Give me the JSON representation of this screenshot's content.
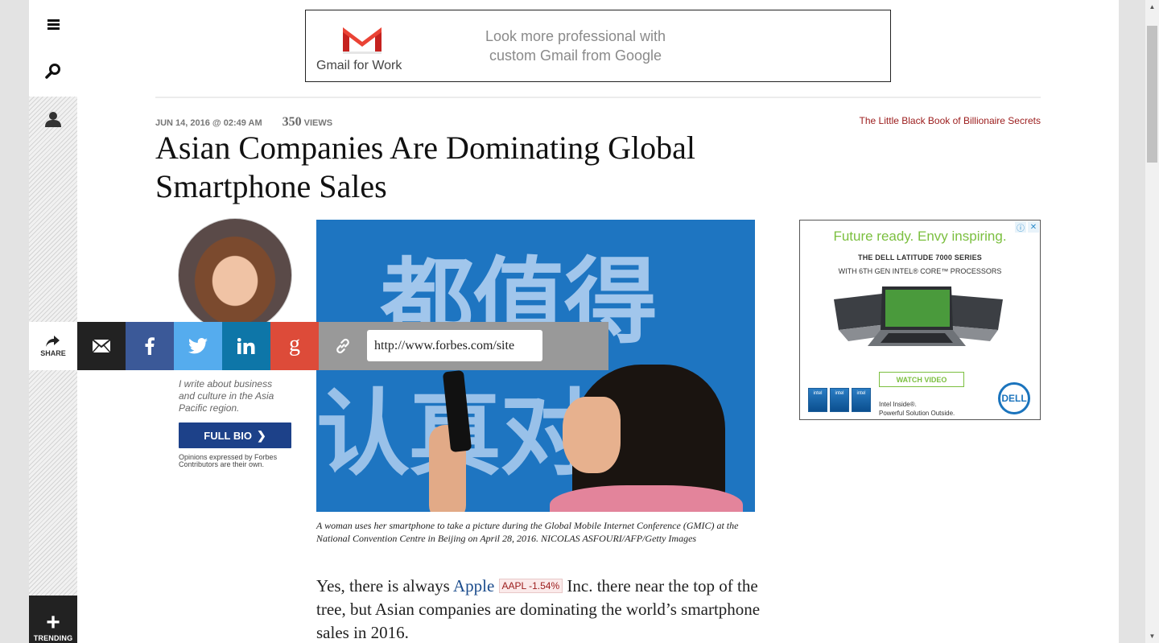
{
  "top_ad": {
    "brand": "Gmail for Work",
    "copy": "Look more professional with custom Gmail from Google"
  },
  "article": {
    "date": "JUN 14, 2016 @ 02:49 AM",
    "views_count": "350",
    "views_label": "VIEWS",
    "promo_link": "The Little Black Book of Billionaire Secrets",
    "headline": "Asian Companies Are Dominating Global Smartphone Sales",
    "caption": "A woman uses her smartphone to take a picture during the Global Mobile Internet Conference (GMIC) at the National Convention Centre in Beijing on April 28, 2016. NICOLAS ASFOURI/AFP/Getty Images",
    "body_before": "Yes, there is always ",
    "body_link": "Apple",
    "ticker": "AAPL -1.54%",
    "body_after": " Inc. there near the top of the tree, but Asian companies are dominating the world’s smartphone sales in 2016."
  },
  "author": {
    "bio": "I write about business and culture in the Asia Pacific region.",
    "full_bio_label": "FULL BIO",
    "disclaimer": "Opinions expressed by Forbes Contributors are their own."
  },
  "share": {
    "label": "SHARE",
    "url": "http://www.forbes.com/site"
  },
  "rail": {
    "trending_label": "TRENDING"
  },
  "side_ad": {
    "headline": "Future ready. Envy inspiring.",
    "line1": "THE DELL LATITUDE 7000 SERIES",
    "line2": "WITH 6TH GEN INTEL® CORE™ PROCESSORS",
    "cta": "WATCH VIDEO",
    "intel1": "Intel Inside®.",
    "intel2": "Powerful Solution Outside.",
    "logo": "DELL"
  },
  "colors": {
    "page_bg": "#e3e3e3",
    "headline_link": "#9b1b1b",
    "full_bio_bg": "#1d4189",
    "facebook": "#3b5998",
    "twitter": "#55acee",
    "linkedin": "#0e76a8",
    "google_plus": "#dd4b39"
  }
}
